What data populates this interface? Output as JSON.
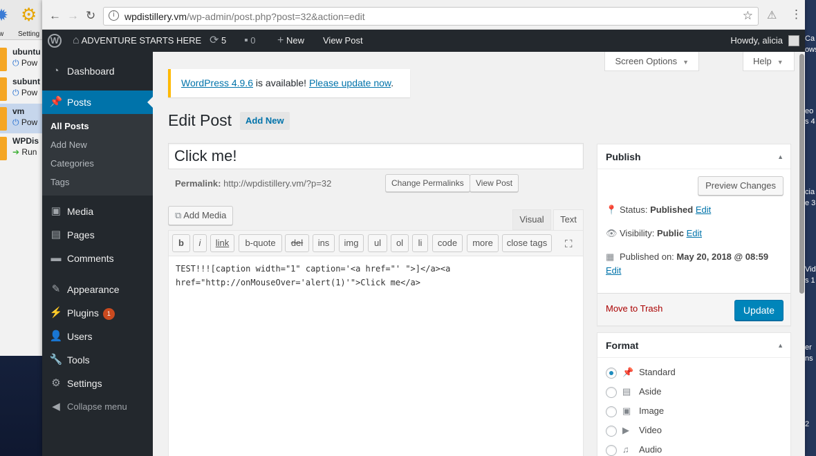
{
  "vm_manager": {
    "toolbar": {
      "new_label": "w",
      "settings_label": "Setting"
    },
    "vms": [
      {
        "name": "ubuntu",
        "status": "Pow"
      },
      {
        "name": "subunt",
        "status": "Pow"
      },
      {
        "name": "vm",
        "status": "Pow"
      },
      {
        "name": "WPDis",
        "status": "Run"
      }
    ]
  },
  "right_window": {
    "texts": [
      "Ca",
      "ows",
      "eo",
      "s 4",
      "cia",
      "e 3",
      "Vid",
      "s 1",
      "er",
      "ns",
      "2"
    ]
  },
  "browser": {
    "url_host": "wpdistillery.vm",
    "url_path": "/wp-admin/post.php?post=32&action=edit"
  },
  "adminbar": {
    "site_name": "ADVENTURE STARTS HERE",
    "updates_count": "5",
    "comments_count": "0",
    "new_label": "New",
    "view_post": "View Post",
    "howdy": "Howdy, alicia"
  },
  "sidebar": {
    "dashboard": "Dashboard",
    "posts": "Posts",
    "posts_sub": [
      "All Posts",
      "Add New",
      "Categories",
      "Tags"
    ],
    "media": "Media",
    "pages": "Pages",
    "comments": "Comments",
    "appearance": "Appearance",
    "plugins": "Plugins",
    "plugins_badge": "1",
    "users": "Users",
    "tools": "Tools",
    "settings": "Settings",
    "collapse": "Collapse menu"
  },
  "screen_options": "Screen Options",
  "help": "Help",
  "notice": {
    "version_link": "WordPress 4.9.6",
    "middle": " is available! ",
    "update_link": "Please update now",
    "end": "."
  },
  "page_title": "Edit Post",
  "add_new_button": "Add New",
  "post_title": "Click me!",
  "permalink": {
    "label": "Permalink:",
    "url": "http://wpdistillery.vm/?p=32",
    "change_button": "Change Permalinks",
    "view_button": "View Post"
  },
  "add_media": "Add Media",
  "editor_tabs": {
    "visual": "Visual",
    "text": "Text"
  },
  "quicktags": [
    "b",
    "i",
    "link",
    "b-quote",
    "del",
    "ins",
    "img",
    "ul",
    "ol",
    "li",
    "code",
    "more",
    "close tags"
  ],
  "content": "TEST!!![caption width=\"1\" caption='<a href=\"' \">]</a><a\nhref=\"http://onMouseOver='alert(1)'\">Click me</a>",
  "publish": {
    "title": "Publish",
    "preview_button": "Preview Changes",
    "status_label": "Status: ",
    "status_value": "Published",
    "visibility_label": "Visibility: ",
    "visibility_value": "Public",
    "published_label": "Published on: ",
    "published_value": "May 20, 2018 @ 08:59",
    "edit_link": "Edit",
    "trash": "Move to Trash",
    "update": "Update"
  },
  "format": {
    "title": "Format",
    "options": [
      "Standard",
      "Aside",
      "Image",
      "Video",
      "Audio"
    ]
  }
}
